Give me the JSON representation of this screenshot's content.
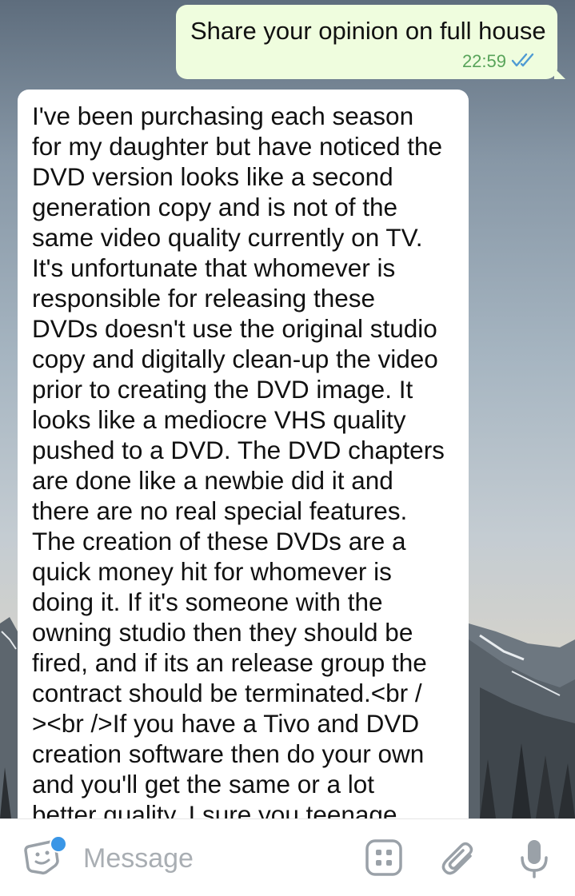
{
  "outgoing_message": {
    "text": "Share your opinion on full house",
    "time": "22:59",
    "status_icon": "double-check-icon"
  },
  "incoming_message": {
    "text": "I've been purchasing each season\nfor my daughter but have noticed the\nDVD version looks like a second\ngeneration copy and is not of the\nsame video quality currently on TV.\nIt's unfortunate that whomever is\nresponsible for releasing these\nDVDs doesn't use the original studio\ncopy and digitally clean-up the video\nprior to creating the DVD image. It\nlooks like a mediocre VHS quality\npushed to a DVD. The DVD chapters\nare done like a newbie did it and\nthere are no real special features.\nThe creation of these DVDs are a\nquick money hit for whomever is\ndoing it. If it's someone with the\nowning studio then they should be\nfired, and if its an release group the\ncontract should be terminated.<br /\n><br />If you have a Tivo and DVD\ncreation software then do your own\nand you'll get the same or a lot\nbetter quality. I sure you teenage"
  },
  "input_bar": {
    "placeholder": "Message",
    "icons": [
      "sticker-icon",
      "bot-commands-icon",
      "attach-icon",
      "microphone-icon"
    ]
  },
  "colors": {
    "outgoing_bubble": "#effdde",
    "incoming_bubble": "#ffffff",
    "time_text": "#58a45a",
    "notification_dot": "#3a96e6"
  }
}
